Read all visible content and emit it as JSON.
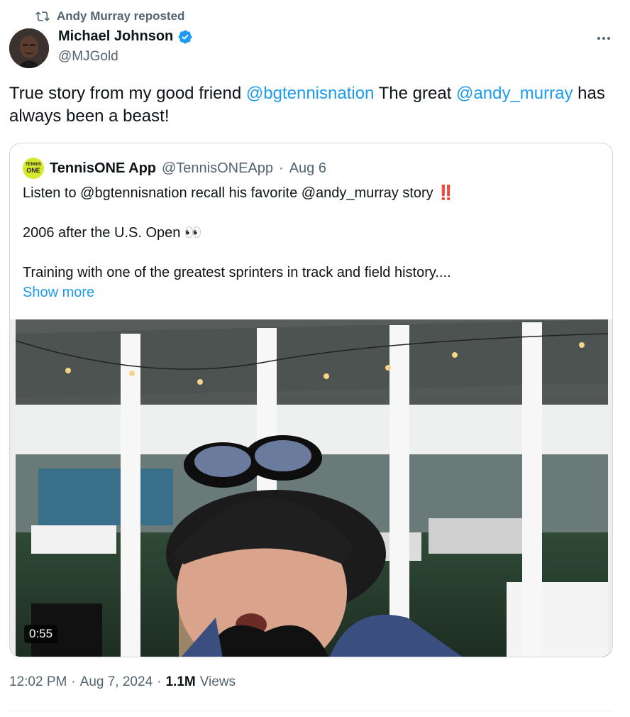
{
  "repost": {
    "text": "Andy Murray reposted",
    "icon": "repost-icon"
  },
  "author": {
    "name": "Michael Johnson",
    "handle": "@MJGold",
    "verified_icon": "verified-badge-icon",
    "avatar_icon": "avatar"
  },
  "more_icon": "more-icon",
  "tweet": {
    "text_1": "True story from my good friend ",
    "mention_1": "@bgtennisnation",
    "text_2": " The great ",
    "mention_2": "@andy_murray",
    "text_3": " has always been a beast!"
  },
  "quote": {
    "avatar_text_top": "TENNIS",
    "avatar_text_bottom": "ONE",
    "name": "TennisONE App",
    "handle": "@TennisONEApp",
    "separator": "·",
    "date": "Aug 6",
    "line_1": "Listen to @bgtennisnation recall his favorite @andy_murray story ‼️",
    "line_2": "2006 after the U.S. Open 👀",
    "line_3": "Training with one of the greatest sprinters in track and field history....",
    "show_more": "Show more",
    "video_duration": "0:55"
  },
  "meta": {
    "time": "12:02 PM",
    "sep_1": "·",
    "date": "Aug 7, 2024",
    "sep_2": "·",
    "views_count": "1.1M",
    "views_label": "Views"
  },
  "colors": {
    "accent": "#1d9bf0",
    "secondary_text": "#536471",
    "border": "#cfd9de",
    "verified": "#1d9bf0"
  }
}
